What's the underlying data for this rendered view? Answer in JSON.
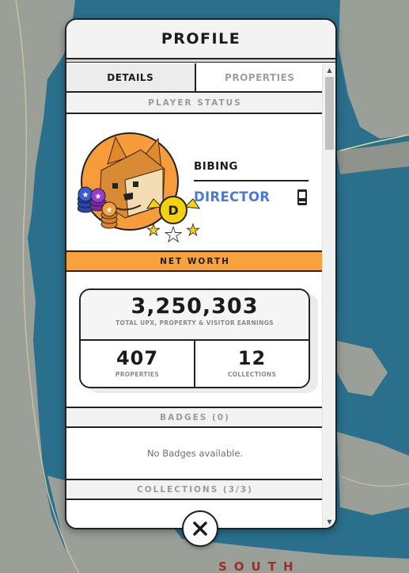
{
  "modal": {
    "title": "PROFILE"
  },
  "tabs": [
    {
      "label": "DETAILS",
      "active": true
    },
    {
      "label": "PROPERTIES",
      "active": false
    }
  ],
  "player_status": {
    "section_label": "PLAYER STATUS",
    "name": "BIBING",
    "rank": "DIRECTOR",
    "rank_badge_letter": "D",
    "rank_color": "#4b7ad6",
    "rank_icon": "smartphone-icon"
  },
  "net_worth": {
    "section_label": "NET WORTH",
    "total_value": "3,250,303",
    "total_caption": "TOTAL UPX, PROPERTY & VISITOR EARNINGS",
    "properties_count": "407",
    "properties_caption": "PROPERTIES",
    "collections_count": "12",
    "collections_caption": "COLLECTIONS",
    "accent_color": "#f7a13f"
  },
  "badges": {
    "section_label": "BADGES (0)",
    "empty_text": "No Badges available."
  },
  "collections": {
    "section_label": "COLLECTIONS (3/3)"
  },
  "map": {
    "label_south": "SOUTH",
    "water_color": "#2a6f8c",
    "land_color": "#9a9f97"
  },
  "icons": {
    "close": "close-icon",
    "scroll_up": "chevron-up-icon",
    "scroll_down": "chevron-down-icon"
  }
}
